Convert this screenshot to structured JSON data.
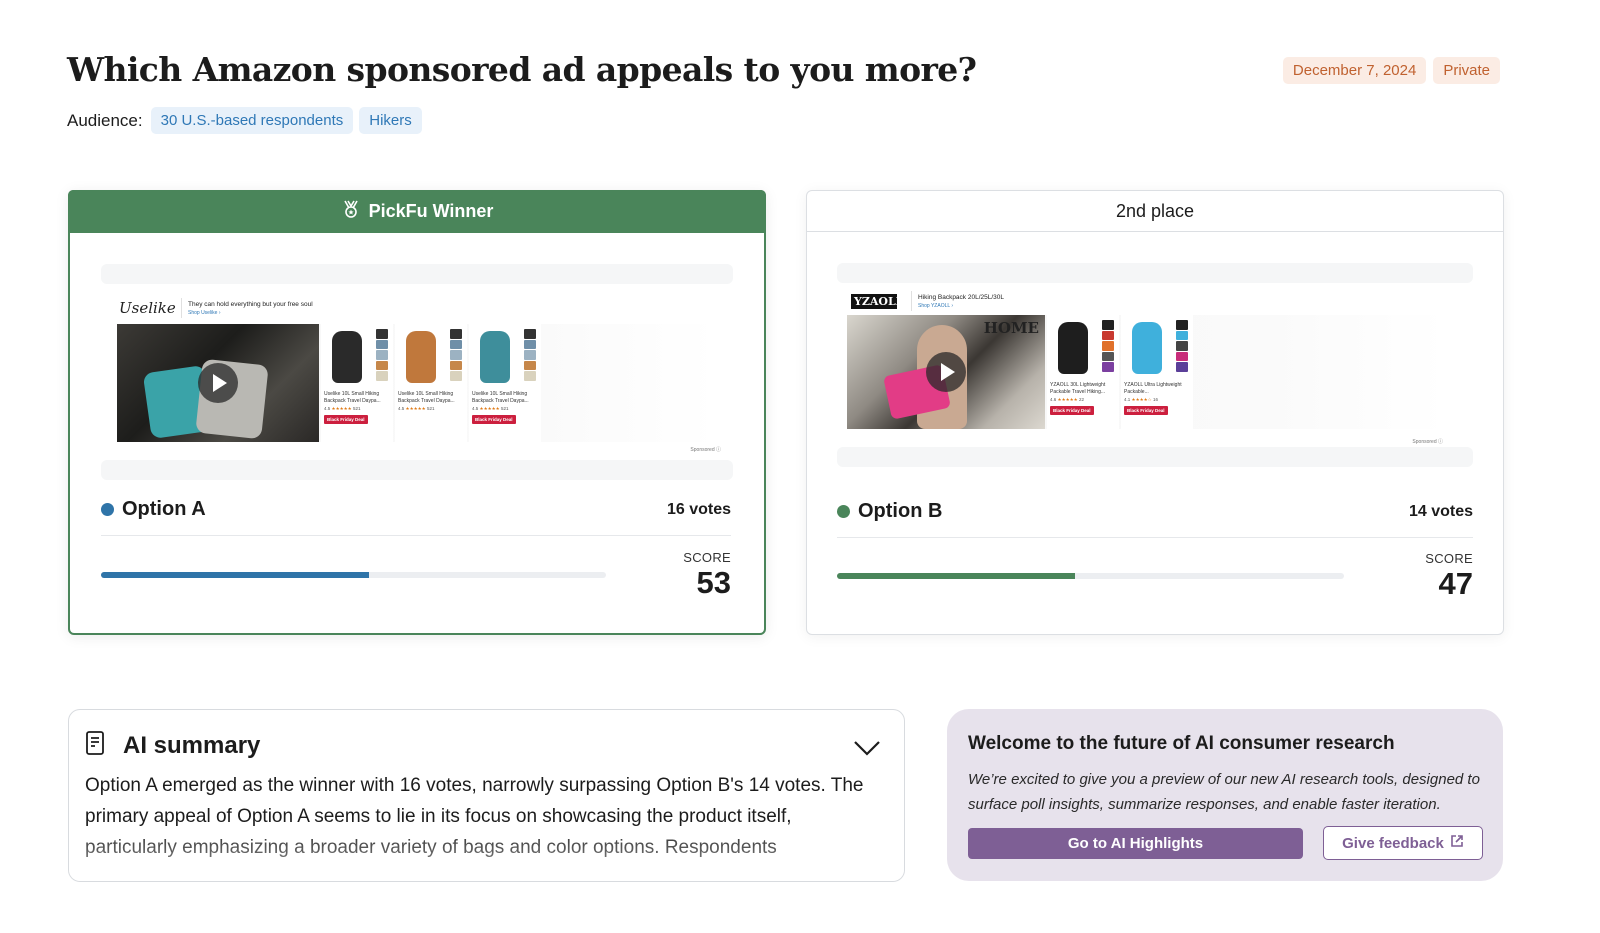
{
  "header": {
    "title": "Which Amazon sponsored ad appeals to you more?",
    "audience_label": "Audience:",
    "audience_tags": [
      "30 U.S.-based respondents",
      "Hikers"
    ],
    "date": "December 7, 2024",
    "visibility": "Private"
  },
  "colors": {
    "winner_green": "#4a855a",
    "option_a_blue": "#2f74a8",
    "option_b_green": "#4a855a",
    "promo_purple": "#7e5f95",
    "badge_orange": "#c0612f"
  },
  "options": [
    {
      "header": "PickFu Winner",
      "header_icon": "medal-icon",
      "name": "Option A",
      "votes": "16 votes",
      "score_label": "SCORE",
      "score": "53",
      "score_fraction": 0.53,
      "ad": {
        "brand": "Uselike",
        "tagline": "They can hold everything but your free soul",
        "shop_link": "Shop Uselike ›",
        "products": [
          {
            "title": "Uselike 10L Small Hiking Backpack Travel Daypa...",
            "rating": "4.5",
            "stars": "★★★★★",
            "count": "521",
            "deal": "Black Friday Deal"
          },
          {
            "title": "Uselike 10L Small Hiking Backpack Travel Daypa...",
            "rating": "4.5",
            "stars": "★★★★★",
            "count": "521",
            "deal": ""
          },
          {
            "title": "Uselike 10L Small Hiking Backpack Travel Daypa...",
            "rating": "4.5",
            "stars": "★★★★★",
            "count": "521",
            "deal": "Black Friday Deal"
          }
        ],
        "sponsored": "Sponsored ⓘ"
      }
    },
    {
      "header": "2nd place",
      "name": "Option B",
      "votes": "14 votes",
      "score_label": "SCORE",
      "score": "47",
      "score_fraction": 0.47,
      "ad": {
        "brand": "YZAOLL",
        "tagline": "Hiking Backpack 20L/25L/30L",
        "shop_link": "Shop YZAOLL ›",
        "video_overlay": "HOME",
        "products": [
          {
            "title": "YZAOLL 30L Lightweight Packable Travel Hiking...",
            "rating": "4.6",
            "stars": "★★★★★",
            "count": "22",
            "deal": "Black Friday Deal"
          },
          {
            "title": "YZAOLL Ultra Lightweight Packable...",
            "rating": "4.1",
            "stars": "★★★★☆",
            "count": "16",
            "deal": "Black Friday Deal"
          }
        ],
        "sponsored": "Sponsored ⓘ"
      }
    }
  ],
  "ai_summary": {
    "title": "AI summary",
    "text": "Option A emerged as the winner with 16 votes, narrowly surpassing Option B's 14 votes. The primary appeal of Option A seems to lie in its focus on showcasing the product itself, particularly emphasizing a broader variety of bags and color options. Respondents"
  },
  "promo": {
    "title": "Welcome to the future of AI consumer research",
    "text": "We’re excited to give you a preview of our new AI research tools, designed to surface poll insights, summarize responses, and enable faster iteration.",
    "primary_button": "Go to AI Highlights",
    "secondary_button": "Give feedback"
  }
}
